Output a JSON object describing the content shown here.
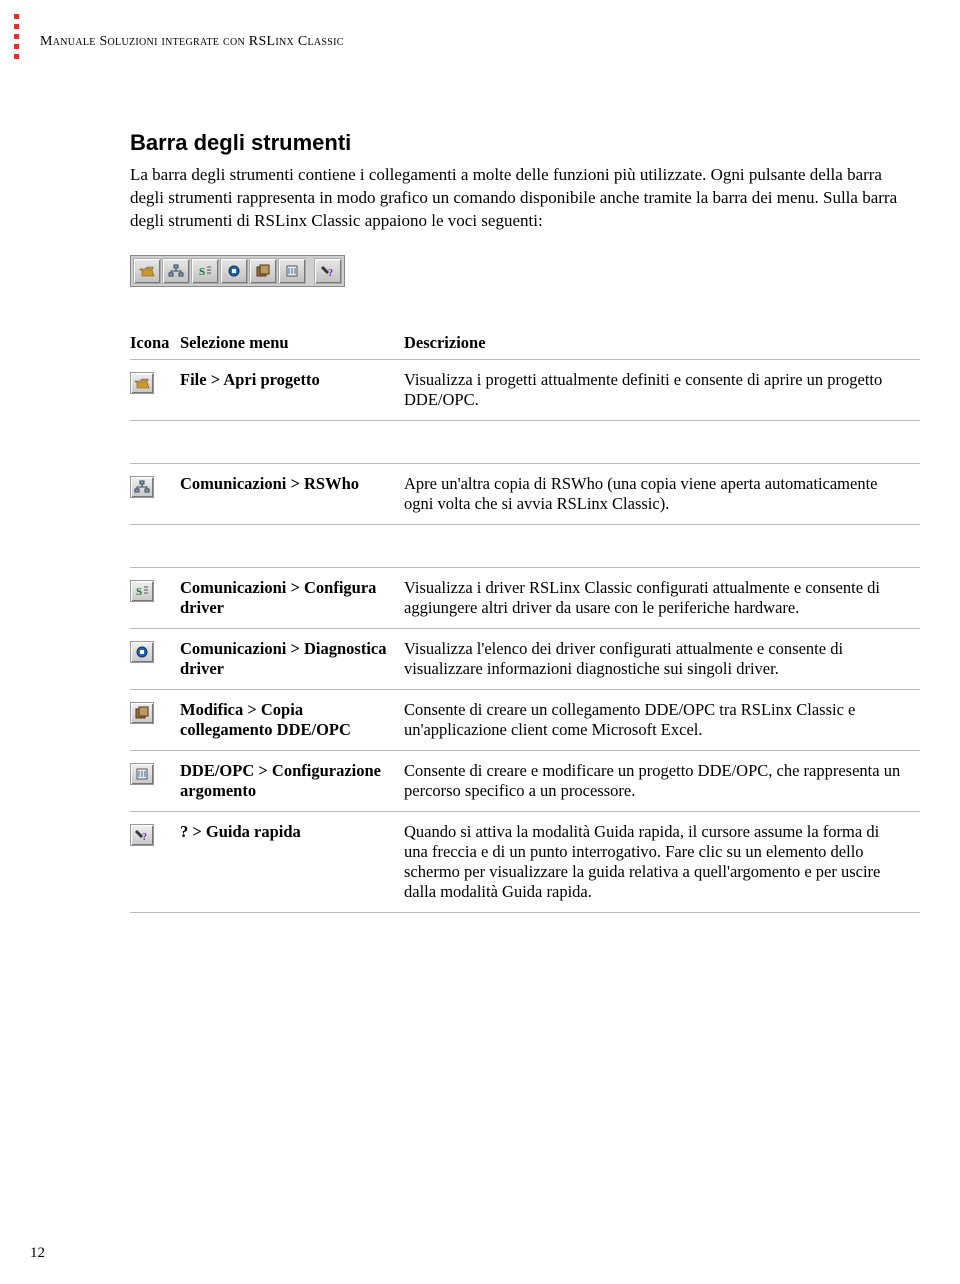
{
  "header": "Manuale Soluzioni integrate con RSLinx Classic",
  "section_title": "Barra degli strumenti",
  "intro": "La barra degli strumenti contiene i collegamenti a molte delle funzioni più utilizzate. Ogni pulsante della barra degli strumenti rappresenta in modo grafico un comando disponibile anche tramite la barra dei menu. Sulla barra degli strumenti di RSLinx Classic appaiono le voci seguenti:",
  "table": {
    "headers": {
      "icon": "Icona",
      "menu": "Selezione menu",
      "desc": "Descrizione"
    },
    "rows": [
      {
        "icon": "open",
        "menu": "File > Apri progetto",
        "desc": "Visualizza i progetti attualmente definiti e consente di aprire un progetto DDE/OPC."
      },
      {
        "icon": "rswho",
        "menu": "Comunicazioni > RSWho",
        "desc": "Apre un'altra copia di RSWho (una copia viene aperta automaticamente ogni volta che si avvia RSLinx Classic)."
      },
      {
        "icon": "configdrv",
        "menu": "Comunicazioni > Configura driver",
        "desc": "Visualizza i driver RSLinx Classic configurati attualmente e consente di aggiungere altri driver da usare con le periferiche hardware."
      },
      {
        "icon": "diagdrv",
        "menu": "Comunicazioni > Diagnostica driver",
        "desc": "Visualizza l'elenco dei driver configurati attualmente e consente di visualizzare informazioni diagnostiche sui singoli driver."
      },
      {
        "icon": "copylink",
        "menu": "Modifica > Copia collegamento DDE/OPC",
        "desc": "Consente di creare un collegamento DDE/OPC tra RSLinx Classic e un'applicazione client come Microsoft Excel."
      },
      {
        "icon": "ddeopc",
        "menu": "DDE/OPC > Configurazione argomento",
        "desc": "Consente di creare e modificare un progetto DDE/OPC, che rappresenta un percorso specifico a un processore."
      },
      {
        "icon": "help",
        "menu": "? > Guida rapida",
        "desc": "Quando si attiva la modalità Guida rapida, il cursore assume la forma di una freccia e di un punto interrogativo. Fare clic su un elemento dello schermo per visualizzare la guida relativa a quell'argomento e per uscire dalla modalità Guida rapida."
      }
    ]
  },
  "page_number": "12",
  "toolbar_icons": [
    "open",
    "rswho",
    "configdrv",
    "diagdrv",
    "copylink",
    "ddeopc",
    "sep",
    "help"
  ]
}
